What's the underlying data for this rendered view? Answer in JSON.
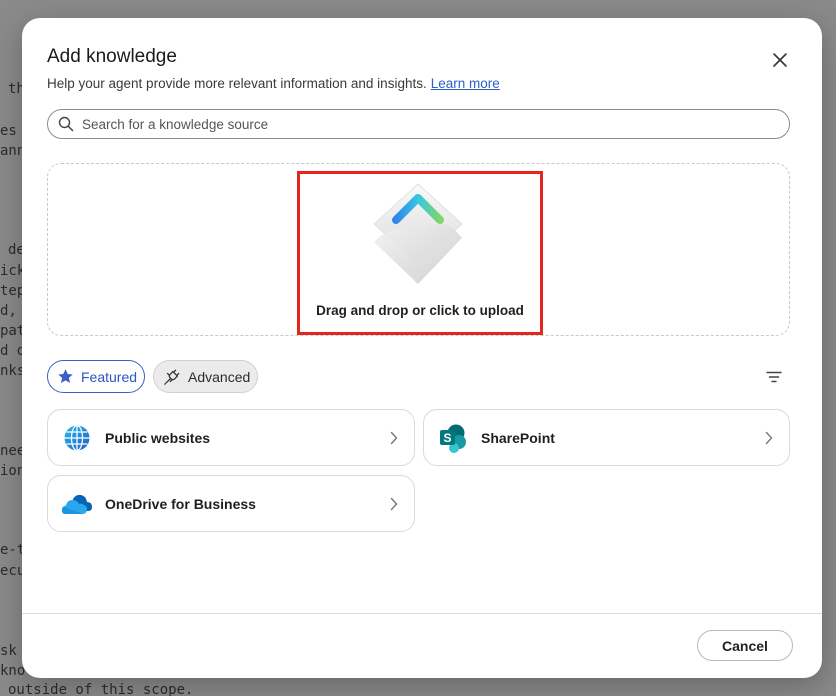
{
  "background_doc": {
    "lines": [
      "th",
      "es",
      "ann",
      "de",
      "ick",
      "tep",
      "d,",
      "pat",
      "d d",
      "nks",
      "nee",
      "ion",
      "e-t",
      "ecu",
      "sk",
      "kno",
      "outside of this scope."
    ]
  },
  "modal": {
    "title": "Add knowledge",
    "subtitle": "Help your agent provide more relevant information and insights.",
    "learn_more": "Learn more",
    "close_label": "Close"
  },
  "search": {
    "placeholder": "Search for a knowledge source",
    "value": ""
  },
  "upload": {
    "label": "Drag and drop or click to upload"
  },
  "filters": {
    "featured": "Featured",
    "advanced": "Advanced"
  },
  "sources": [
    {
      "name": "Public websites",
      "icon": "globe-icon"
    },
    {
      "name": "SharePoint",
      "icon": "sharepoint-icon"
    },
    {
      "name": "OneDrive for Business",
      "icon": "onedrive-icon"
    }
  ],
  "footer": {
    "cancel": "Cancel"
  },
  "colors": {
    "accent": "#2f54c4",
    "highlight_border": "#e5261f",
    "link": "#2b5ec9"
  }
}
